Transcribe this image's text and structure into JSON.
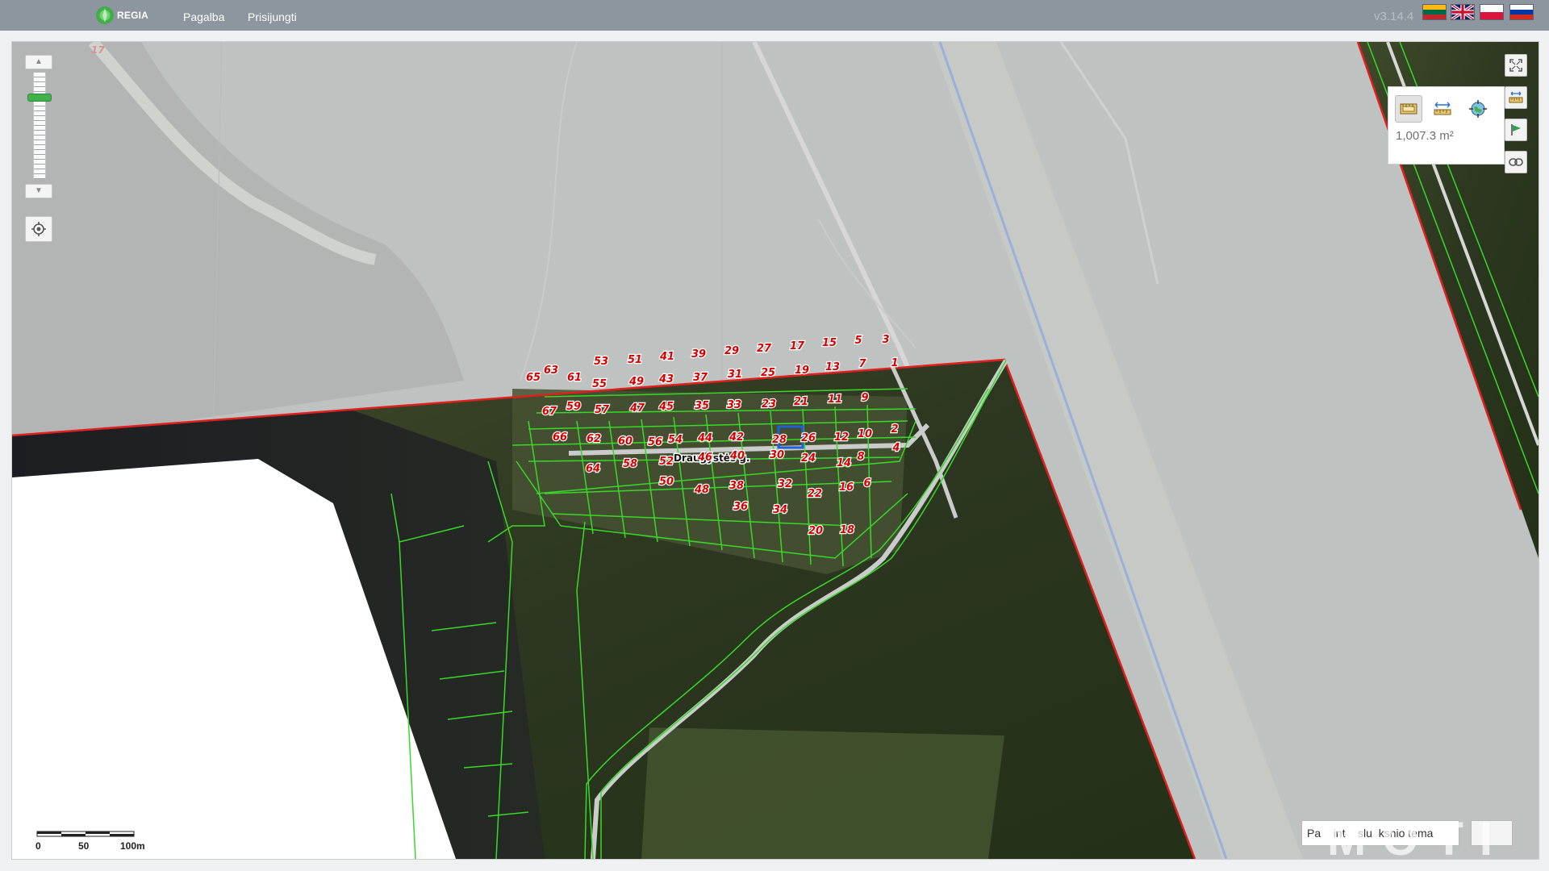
{
  "header": {
    "logo_text": "REGIA",
    "nav": [
      "Pagalba",
      "Prisijungti"
    ],
    "version": "v3.14.4",
    "languages": [
      "lt",
      "en",
      "pl",
      "ru"
    ]
  },
  "map": {
    "street_label": "Draugystės g.",
    "corner_parcel_label": "17",
    "parcels": [
      "63",
      "65",
      "61",
      "53",
      "51",
      "41",
      "39",
      "29",
      "27",
      "17",
      "15",
      "5",
      "3",
      "55",
      "49",
      "43",
      "37",
      "31",
      "25",
      "19",
      "13",
      "7",
      "1",
      "59",
      "67",
      "57",
      "47",
      "45",
      "35",
      "33",
      "23",
      "21",
      "11",
      "9",
      "66",
      "62",
      "60",
      "56",
      "54",
      "44",
      "42",
      "28",
      "26",
      "12",
      "10",
      "2",
      "58",
      "14",
      "8",
      "4",
      "64",
      "52",
      "46",
      "40",
      "30",
      "24",
      "50",
      "48",
      "38",
      "32",
      "22",
      "16",
      "6",
      "36",
      "34",
      "20",
      "18"
    ],
    "measurement_value": "1,007.3 m²",
    "layer_input_value": "Pa    int    slu  ksnio tema",
    "watermark_text": "MOTI",
    "scale_labels": [
      "0",
      "50",
      "100m"
    ],
    "icons": {
      "zoom_in": "chevron-up-icon",
      "zoom_out": "chevron-down-icon",
      "locate": "locate-target-icon",
      "fullscreen": "fullscreen-icon",
      "measure": "ruler-icon",
      "flag": "flag-icon",
      "link": "link-icon",
      "measure_area": "area-ruler-icon",
      "measure_distance": "distance-ruler-icon",
      "coordinates": "globe-target-icon"
    },
    "colors": {
      "parcel_boundary": "#39d82a",
      "region_boundary": "#e01f1f",
      "parcel_label": "#d40000",
      "selected_parcel": "#1f5fd8"
    }
  }
}
